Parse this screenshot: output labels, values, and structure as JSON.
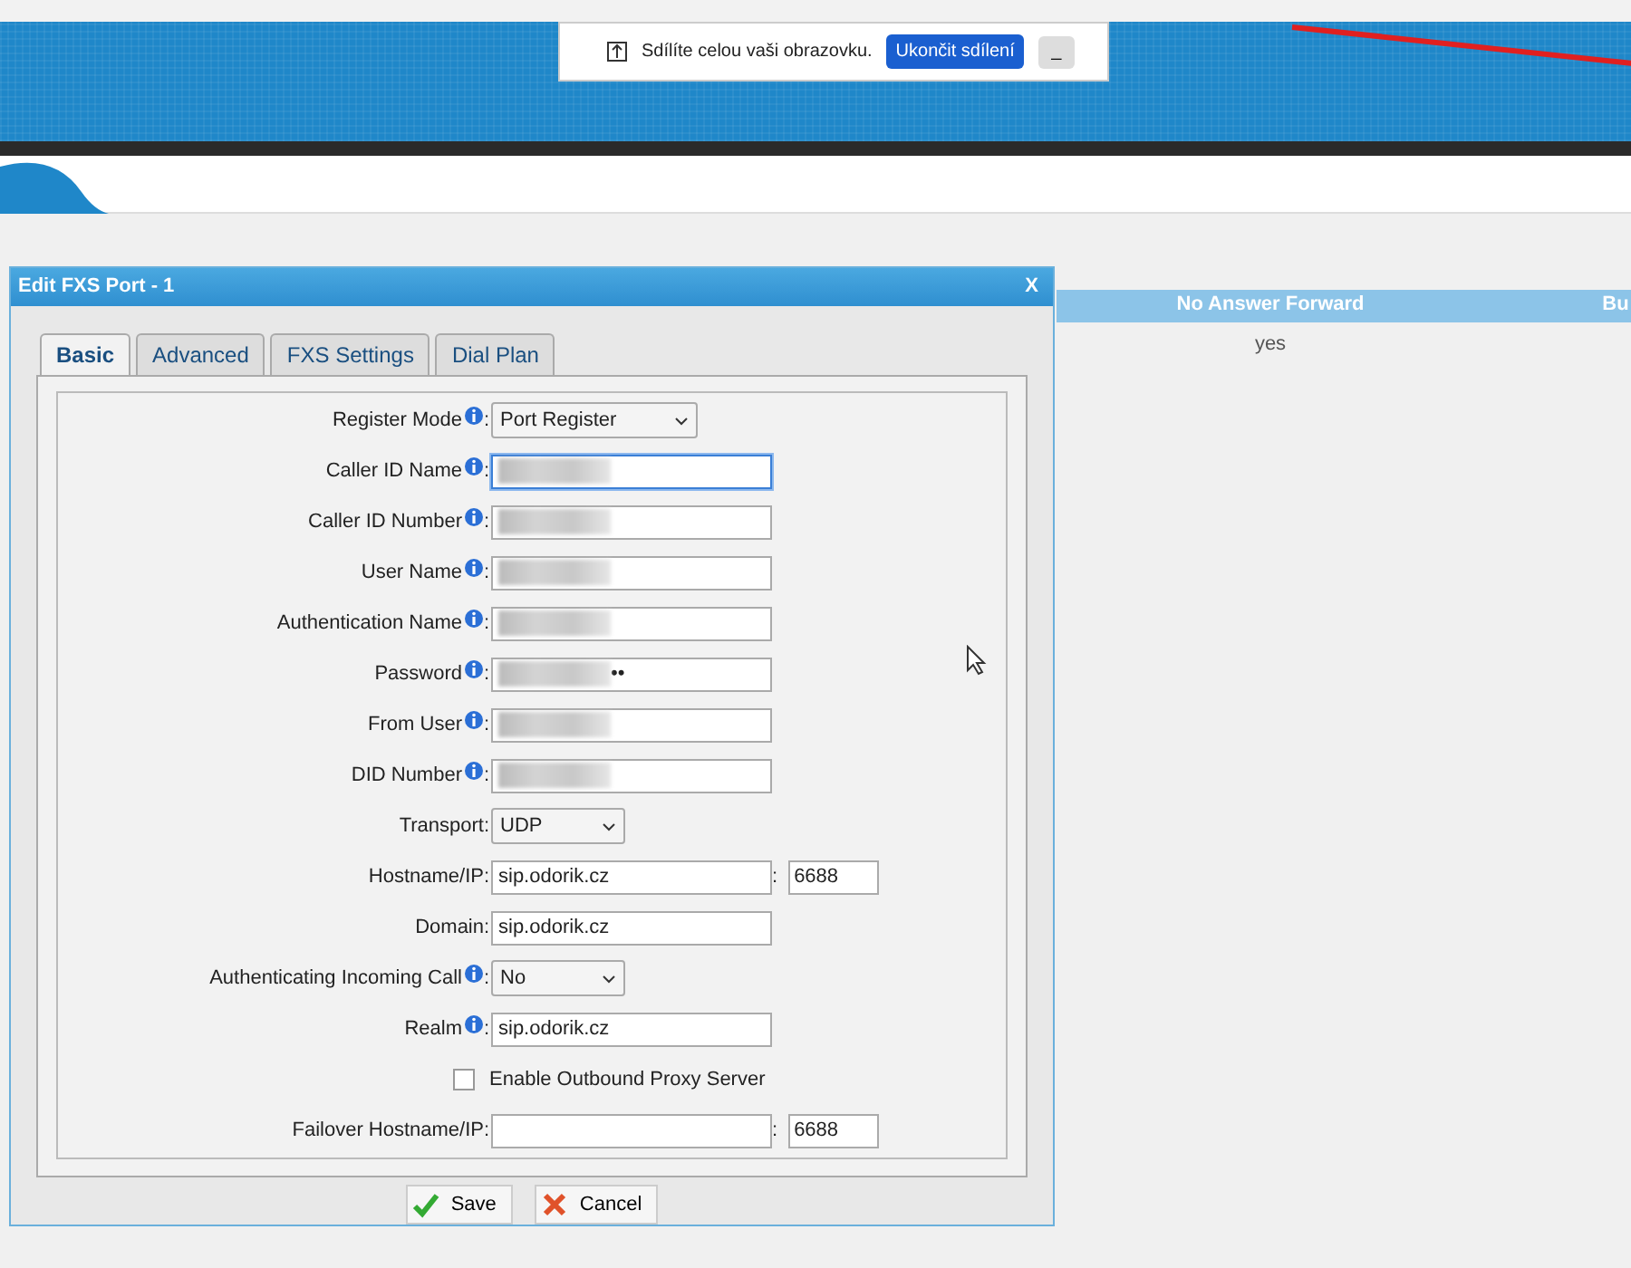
{
  "share_bar": {
    "message": "Sdílíte celou vaši obrazovku.",
    "stop_button": "Ukončit sdílení",
    "minimize_button": "_"
  },
  "background_table": {
    "columns": [
      "No Answer Forward",
      "Bu"
    ],
    "rows": [
      [
        "yes",
        ""
      ]
    ]
  },
  "dialog": {
    "title": "Edit FXS Port - 1",
    "close": "X",
    "tabs": [
      {
        "label": "Basic",
        "selected": true
      },
      {
        "label": "Advanced",
        "selected": false
      },
      {
        "label": "FXS Settings",
        "selected": false
      },
      {
        "label": "Dial Plan",
        "selected": false
      }
    ],
    "rows": [
      {
        "kind": "select",
        "label": "Register Mode",
        "info": true,
        "separator": ":",
        "value": "Port Register",
        "narrow": false
      },
      {
        "kind": "text",
        "label": "Caller ID Name",
        "info": true,
        "separator": ":",
        "redacted": true,
        "focused": true
      },
      {
        "kind": "text",
        "label": "Caller ID Number",
        "info": true,
        "separator": ":",
        "redacted": true
      },
      {
        "kind": "text",
        "label": "User Name",
        "info": true,
        "separator": ":",
        "redacted": true
      },
      {
        "kind": "text",
        "label": "Authentication Name",
        "info": true,
        "separator": ":",
        "redacted": true
      },
      {
        "kind": "text",
        "label": "Password",
        "info": true,
        "separator": ":",
        "redacted": true,
        "value": "••"
      },
      {
        "kind": "text",
        "label": "From User",
        "info": true,
        "separator": ":",
        "redacted": true
      },
      {
        "kind": "text",
        "label": "DID Number",
        "info": true,
        "separator": ":",
        "redacted": true
      },
      {
        "kind": "select",
        "label": "Transport",
        "info": false,
        "separator": ":",
        "value": "UDP",
        "narrow": true
      },
      {
        "kind": "host",
        "label": "Hostname/IP",
        "info": false,
        "separator": ":",
        "value": "sip.odorik.cz",
        "port_separator": ":",
        "port": "6688"
      },
      {
        "kind": "text",
        "label": "Domain",
        "info": false,
        "separator": ":",
        "value": "sip.odorik.cz"
      },
      {
        "kind": "select",
        "label": "Authenticating Incoming Call",
        "info": true,
        "separator": ":",
        "value": "No",
        "narrow": true
      },
      {
        "kind": "text",
        "label": "Realm",
        "info": true,
        "separator": ":",
        "value": "sip.odorik.cz"
      },
      {
        "kind": "checkbox",
        "label": "Enable Outbound Proxy Server",
        "checked": false
      },
      {
        "kind": "host",
        "label": "Failover Hostname/IP",
        "info": false,
        "separator": ":",
        "port_separator": ":",
        "port": "6688"
      }
    ],
    "buttons": [
      {
        "kind": "save",
        "label": "Save"
      },
      {
        "kind": "cancel",
        "label": "Cancel"
      }
    ]
  }
}
